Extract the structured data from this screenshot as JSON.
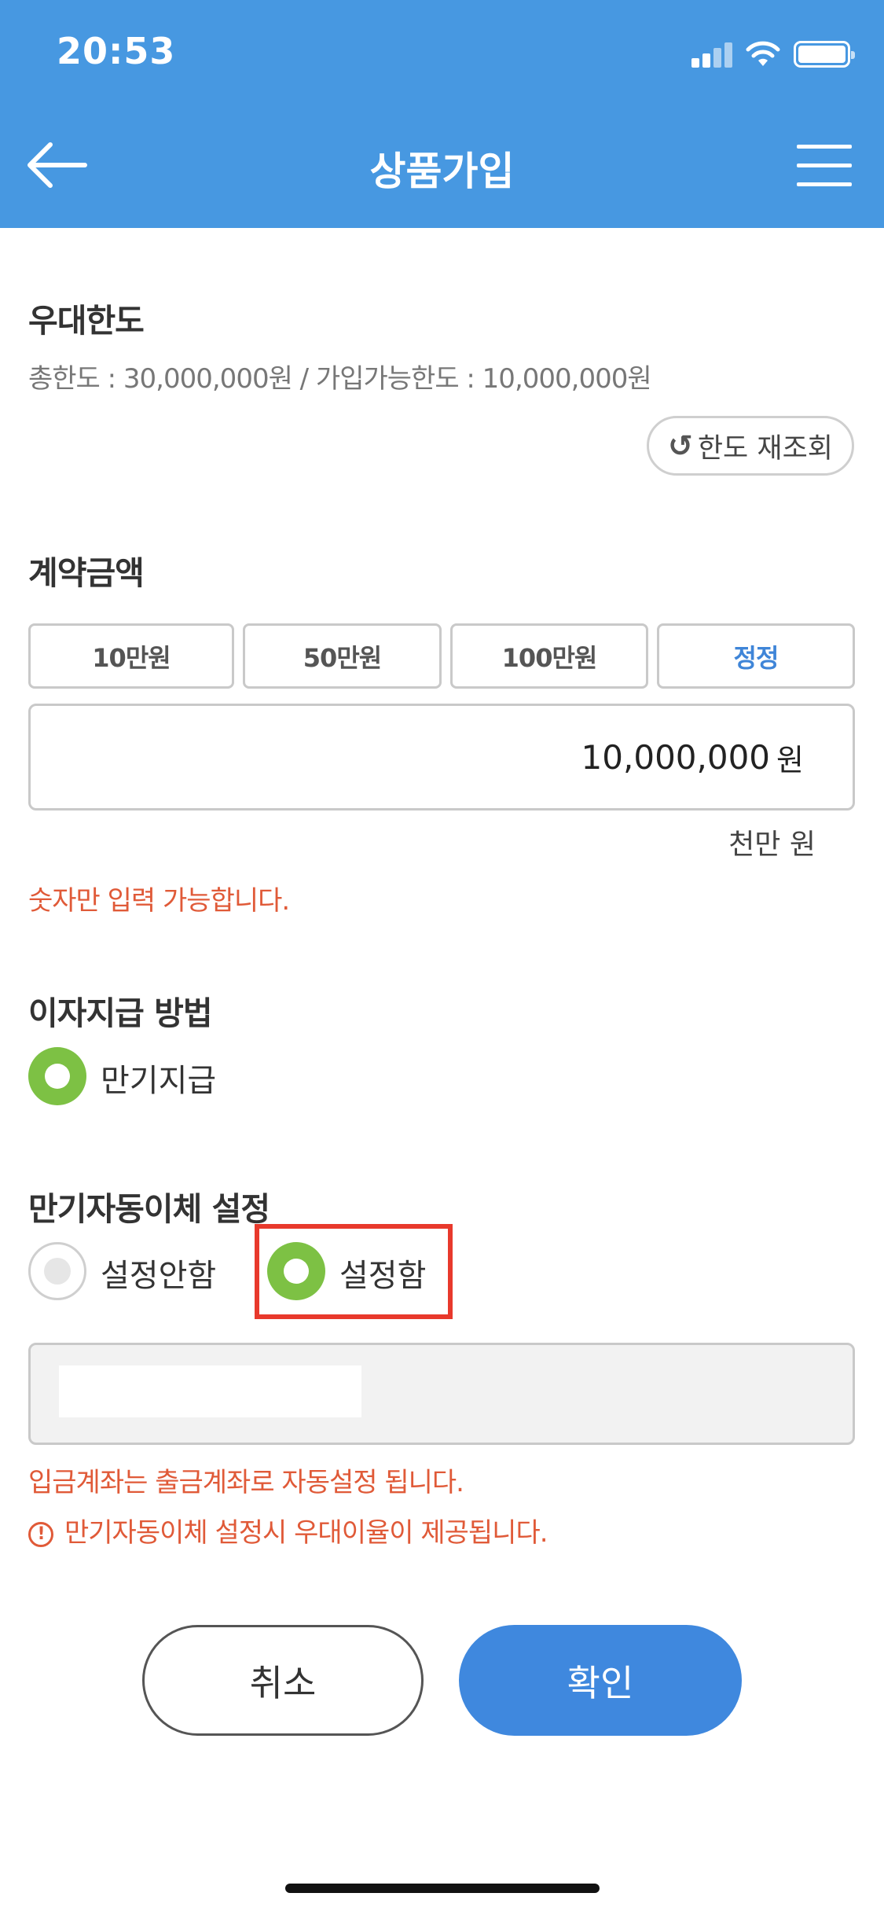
{
  "status_bar": {
    "time": "20:53"
  },
  "header": {
    "title": "상품가입"
  },
  "limit": {
    "title": "우대한도",
    "desc": "총한도 : 30,000,000원 / 가입가능한도 : 10,000,000원",
    "refresh_label": "한도 재조회"
  },
  "contract": {
    "title": "계약금액",
    "quick_buttons": [
      "10만원",
      "50만원",
      "100만원",
      "정정"
    ],
    "amount": "10,000,000",
    "unit": "원",
    "amount_korean": "천만 원",
    "error": "숫자만 입력 가능합니다."
  },
  "interest": {
    "title": "이자지급 방법",
    "option": "만기지급"
  },
  "auto_transfer": {
    "title": "만기자동이체 설정",
    "options": [
      "설정안함",
      "설정함"
    ],
    "selected": "설정함",
    "notice1": "입금계좌는 출금계좌로 자동설정 됩니다.",
    "notice2": "만기자동이체 설정시 우대이율이 제공됩니다."
  },
  "actions": {
    "cancel": "취소",
    "confirm": "확인"
  },
  "colors": {
    "header": "#4798e1",
    "accent": "#3f88de",
    "radio": "#7dc144",
    "error": "#e05a38",
    "highlight": "#e8392c"
  }
}
